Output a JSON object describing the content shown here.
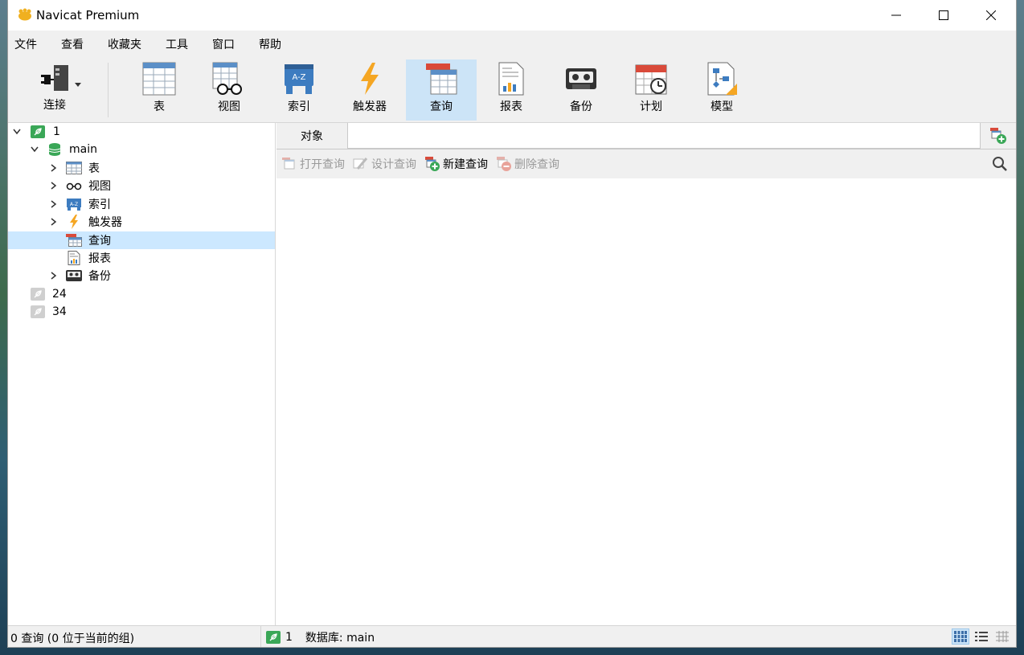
{
  "window": {
    "title": "Navicat Premium"
  },
  "menu": [
    "文件",
    "查看",
    "收藏夹",
    "工具",
    "窗口",
    "帮助"
  ],
  "toolbar": {
    "connect": "连接",
    "table": "表",
    "view": "视图",
    "index": "索引",
    "trigger": "触发器",
    "query": "查询",
    "report": "报表",
    "backup": "备份",
    "schedule": "计划",
    "model": "模型",
    "active": "查询"
  },
  "tree": {
    "conn1": "1",
    "db": "main",
    "items": [
      "表",
      "视图",
      "索引",
      "触发器",
      "查询",
      "报表",
      "备份"
    ],
    "selected": "查询",
    "conn2": "24",
    "conn3": "34"
  },
  "object_tab": {
    "label": "对象"
  },
  "object_toolbar": {
    "open": "打开查询",
    "design": "设计查询",
    "new": "新建查询",
    "delete": "删除查询"
  },
  "status": {
    "left": "0 查询 (0 位于当前的组)",
    "conn": "1",
    "db": "数据库: main"
  },
  "colors": {
    "accent": "#cce4f7",
    "selection": "#cce8ff",
    "conn_green": "#3aa757"
  }
}
